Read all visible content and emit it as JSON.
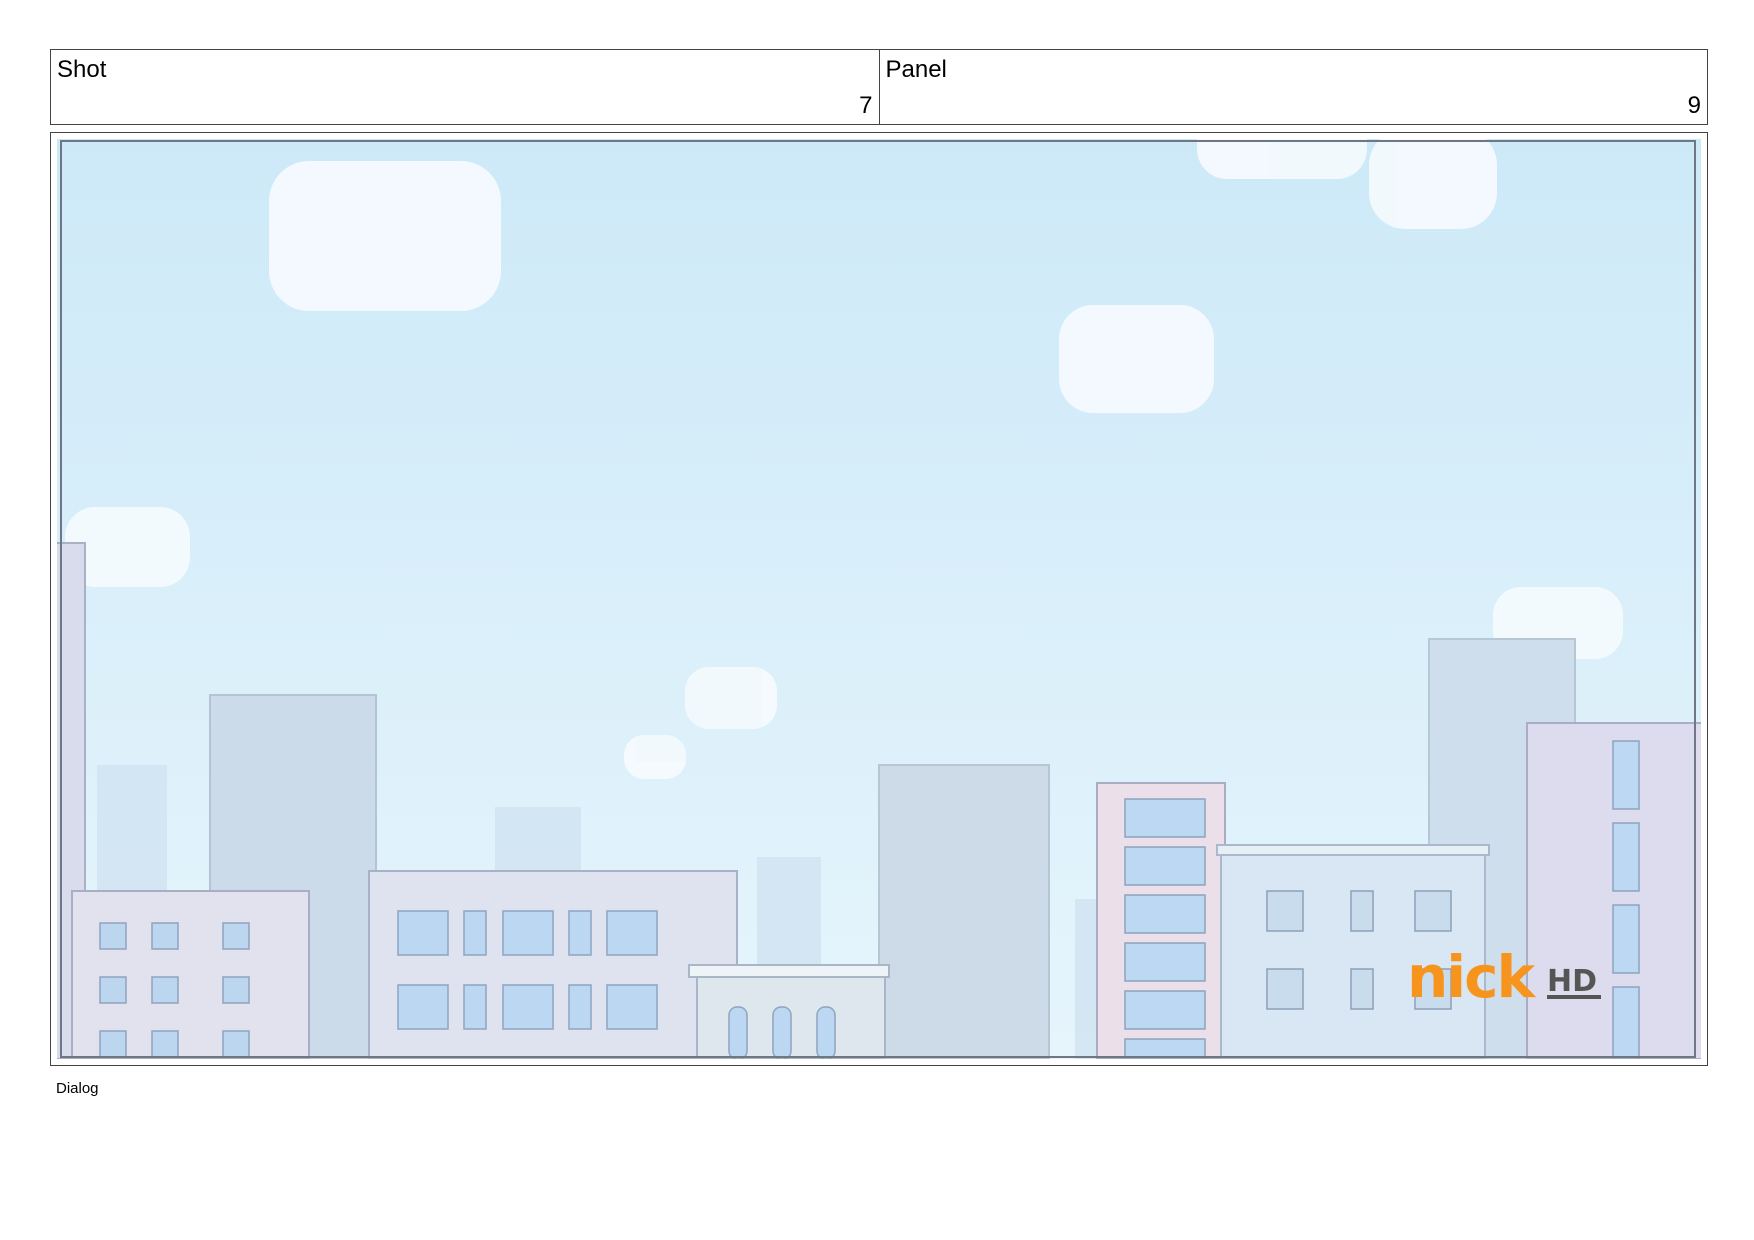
{
  "header": {
    "shot_label": "Shot",
    "shot_number": "7",
    "panel_label": "Panel",
    "panel_number": "9"
  },
  "frame": {
    "scene": "city-skyline",
    "logo": {
      "text": "nick",
      "badge": "HD",
      "color": "#f7941d"
    }
  },
  "dialog": {
    "label": "Dialog"
  },
  "colors": {
    "sky_top": "#cde9f8",
    "sky_bottom": "#e6f5fc",
    "building_light": "#dfe4f0",
    "building_blue": "#c9dcee",
    "window": "#b9d8f2",
    "logo_orange": "#f7941d"
  }
}
